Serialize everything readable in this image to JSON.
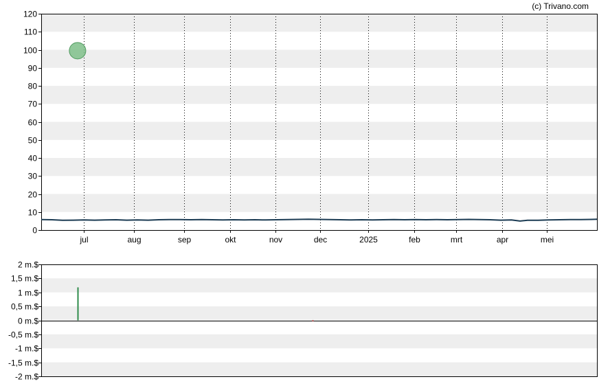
{
  "copyright": "(c) Trivano.com",
  "chart_data": [
    {
      "type": "line",
      "title": "",
      "xlabel": "",
      "ylabel": "",
      "ylim": [
        0,
        120
      ],
      "y_ticks": [
        0,
        10,
        20,
        30,
        40,
        50,
        60,
        70,
        80,
        90,
        100,
        110,
        120
      ],
      "x_range": [
        0,
        52
      ],
      "x_ticks": [
        {
          "label": "jul",
          "x": 4
        },
        {
          "label": "aug",
          "x": 8.7
        },
        {
          "label": "sep",
          "x": 13.4
        },
        {
          "label": "okt",
          "x": 17.7
        },
        {
          "label": "nov",
          "x": 21.9
        },
        {
          "label": "dec",
          "x": 26.1
        },
        {
          "label": "2025",
          "x": 30.6
        },
        {
          "label": "feb",
          "x": 34.9
        },
        {
          "label": "mrt",
          "x": 38.8
        },
        {
          "label": "apr",
          "x": 43.1
        },
        {
          "label": "mei",
          "x": 47.3
        }
      ],
      "grid": "horizontal bands, dotted vertical month lines",
      "colors": {
        "line": "#1a3a52",
        "band": "#eeeeee",
        "marker": "#7fbf8a"
      },
      "series": [
        {
          "x": [
            0,
            1,
            2,
            3,
            4,
            5,
            6,
            7,
            8,
            9,
            10,
            11,
            12,
            13,
            14,
            15,
            16,
            17,
            18,
            19,
            20,
            21,
            22,
            23,
            24,
            25,
            26,
            27,
            28,
            29,
            30,
            31,
            32,
            33,
            34,
            35,
            36,
            37,
            38,
            39,
            40,
            41,
            42,
            43,
            44,
            44.8,
            45.5,
            46.5,
            47.5,
            48.5,
            49.5,
            50.5,
            51.5,
            52
          ],
          "values": [
            5.8,
            5.7,
            5.4,
            5.5,
            5.6,
            5.5,
            5.6,
            5.7,
            5.5,
            5.6,
            5.5,
            5.7,
            5.8,
            5.8,
            5.7,
            5.8,
            5.7,
            5.6,
            5.7,
            5.6,
            5.7,
            5.6,
            5.7,
            5.8,
            5.9,
            6.0,
            5.9,
            5.8,
            5.7,
            5.6,
            5.7,
            5.6,
            5.7,
            5.8,
            5.7,
            5.8,
            5.7,
            5.8,
            5.7,
            5.8,
            5.9,
            5.8,
            5.7,
            5.5,
            5.6,
            5.0,
            5.4,
            5.4,
            5.6,
            5.7,
            5.8,
            5.8,
            5.9,
            6.0
          ]
        }
      ],
      "markers": [
        {
          "x": 3.4,
          "y": 99.5
        }
      ]
    },
    {
      "type": "bar",
      "title": "",
      "ylim": [
        -2,
        2
      ],
      "y_ticks": [
        {
          "value": 2,
          "label": "2 m.$"
        },
        {
          "value": 1.5,
          "label": "1,5 m.$"
        },
        {
          "value": 1,
          "label": "1 m.$"
        },
        {
          "value": 0.5,
          "label": "0,5 m.$"
        },
        {
          "value": 0,
          "label": "0 m.$"
        },
        {
          "value": -0.5,
          "label": "-0,5 m.$"
        },
        {
          "value": -1,
          "label": "-1 m.$"
        },
        {
          "value": -1.5,
          "label": "-1,5 m.$"
        },
        {
          "value": -2,
          "label": "-2 m.$"
        }
      ],
      "x_range": [
        0,
        52
      ],
      "grid": "horizontal bands",
      "colors": {
        "positive": "#2e8b4a",
        "negative": "#cc2222",
        "band": "#eeeeee"
      },
      "bars": [
        {
          "x": 3.4,
          "value": 1.18
        },
        {
          "x": 25.4,
          "value": -0.03
        }
      ]
    }
  ]
}
